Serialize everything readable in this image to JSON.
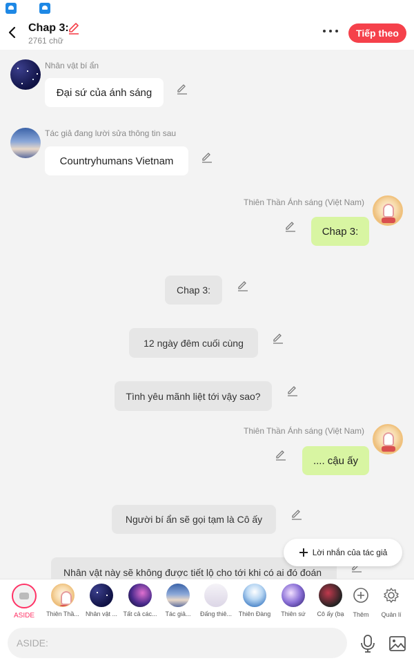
{
  "header": {
    "title": "Chap 3:",
    "word_count": "2761 chữ",
    "next_label": "Tiếp theo"
  },
  "messages": [
    {
      "side": "left",
      "author": "Nhân vật bí ẩn",
      "text": "Đại sứ của ánh sáng"
    },
    {
      "side": "left",
      "author": "Tác giả đang lười sửa thông tin sau",
      "text": "Countryhumans Vietnam"
    },
    {
      "side": "right",
      "author": "Thiên Thần Ánh sáng (Việt Nam)",
      "text": "Chap 3:"
    },
    {
      "side": "center",
      "text": "Chap 3:"
    },
    {
      "side": "center",
      "text": "12 ngày đêm cuối cùng"
    },
    {
      "side": "center",
      "text": "Tình yêu mãnh liệt tới vậy sao?"
    },
    {
      "side": "right",
      "author": "Thiên Thần Ánh sáng (Việt Nam)",
      "text": ".... cậu ấy"
    },
    {
      "side": "center",
      "text": "Người bí ẩn sẽ gọi tạm là Cô ấy"
    },
    {
      "side": "center",
      "text": "Nhân vật này sẽ không được tiết lộ cho tới khi có ai đó đoán"
    }
  ],
  "author_note_button": "Lời nhắn của tác giả",
  "characters": [
    {
      "label": "ASIDE"
    },
    {
      "label": "Thiên Thầ..."
    },
    {
      "label": "Nhân vật ..."
    },
    {
      "label": "Tất cả các..."
    },
    {
      "label": "Tác giả..."
    },
    {
      "label": "Đấng thiê..."
    },
    {
      "label": "Thiên Đàng"
    },
    {
      "label": "Thiên sứ"
    },
    {
      "label": "Cô ấy (bạ"
    },
    {
      "label": "Thêm"
    },
    {
      "label": "Quản lí"
    }
  ],
  "input": {
    "placeholder": "ASIDE:"
  },
  "colors": {
    "accent": "#f5414b",
    "green_bubble": "#d8f5a2",
    "gray_bubble": "#e6e6e6"
  }
}
